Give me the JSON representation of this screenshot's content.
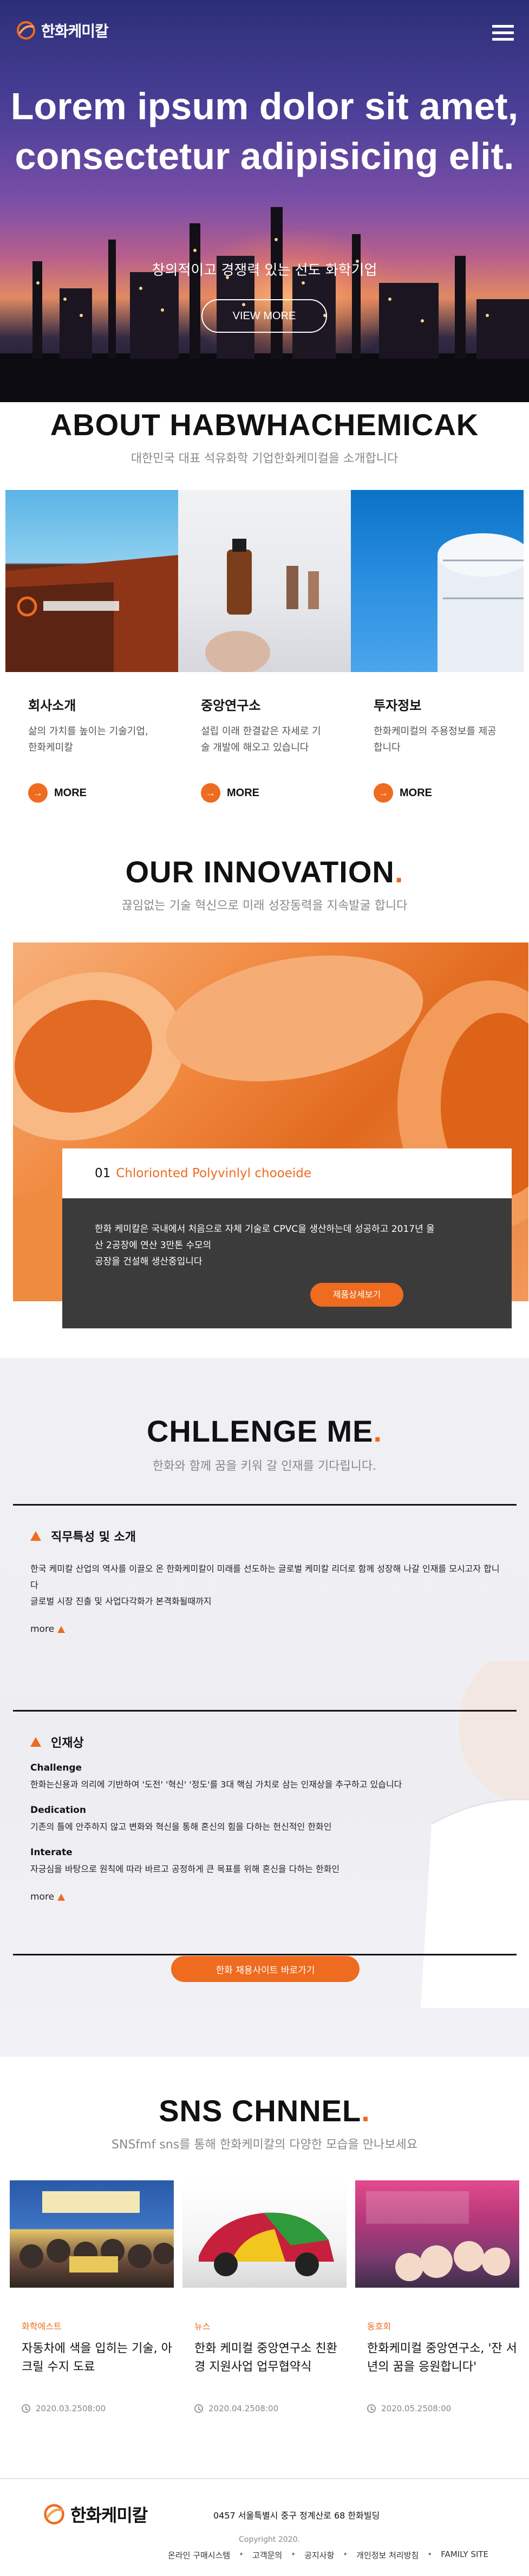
{
  "brand": {
    "logo_text": "한화케미칼",
    "accent": "#ee6b1f"
  },
  "hero": {
    "title": "Lorem ipsum dolor sit amet, consectetur adipisicing elit.",
    "subtitle": "창의적이고 경쟁력 있는 선도 화학기업",
    "button": "VIEW MORE"
  },
  "about": {
    "title": "ABOUT HABWHACHEMICAK",
    "subtitle": "대한민국 대표 석유화학 기업한화케미컬을 소개합니다",
    "cards": [
      {
        "title": "회사소개",
        "text": "삶의 가치를 높이는 기술기업, 한화케미칼",
        "more": "MORE"
      },
      {
        "title": "중앙연구소",
        "text": "설립 이래 한결같은 자세로 기술 개발에 해오고 있습니다",
        "more": "MORE"
      },
      {
        "title": "투자정보",
        "text": "한화케미컬의 주용정보를 제공합니다",
        "more": "MORE"
      }
    ]
  },
  "innovation": {
    "title": "OUR INNOVATION",
    "title_dot": ".",
    "subtitle": "끊임없는 기술 혁신으로 미래 성장동력을 지속발굴 합니다",
    "card": {
      "number": "01",
      "name": "Chlorionted Polyvinlyl chooeide",
      "line1": "한화 케미칼은 국내에서 처음으로 자체 기술로 CPVC을 생산하는데 성공하고 2017년 울산 2공장에 연산 3만톤 수모의",
      "line2": "공장을 건설해 생산중입니다",
      "button": "제품상세보기"
    }
  },
  "challenge": {
    "title": "CHLLENGE ME",
    "title_dot": ".",
    "subtitle": "한화와 함께 꿈을 키워 갈 인재를 기다립니다.",
    "items": [
      {
        "heading": "직무특성 및 소개",
        "text1": "한국 케미칼 산업의 역사를 이끌오 온 한화케미칼이 미래를 선도하는 글로벌 케미칼 리더로 함께 성장해 나갈 인재를 모시고자 합니다",
        "text2": "글로벌 시장 진출 및 사업다각화가 본격화될때까지",
        "more": "more"
      },
      {
        "heading": "인재상",
        "subs": [
          {
            "title": "Challenge",
            "text": "한화는신용과 의리에 기반하여 '도전' '혁신' '정도'를 3대 핵심 가치로 삼는 인재상을 추구하고 있습니다"
          },
          {
            "title": "Dedication",
            "text": "기존의 틀에 안주하지 않고 변화와 혁신을 통해 혼신의 힘을 다하는 헌신적인 한화인"
          },
          {
            "title": "Interate",
            "text": "자긍심을 바탕으로 원칙에 따라 바르고 공정하게 큰 목표를 위해 혼신을 다하는 한화인"
          }
        ],
        "more": "more"
      }
    ],
    "button": "한화 채용사이트 바로가기"
  },
  "sns": {
    "title": "SNS CHNNEL",
    "title_dot": ".",
    "subtitle": "SNSfmf sns를 통해 한화케미칼의 다양한 모습을 만나보세요",
    "posts": [
      {
        "category": "화학에스트",
        "title": "자동차에 색을 입히는 기술, 아크릴 수지 도료",
        "date": "2020.03.2508:00"
      },
      {
        "category": "뉴스",
        "title": "한화 케미컬 중앙연구소 친환경 지원사업 업무협약식",
        "date": "2020.04.2508:00"
      },
      {
        "category": "동호회",
        "title": "한화케미컬 중앙연구소, '잔 서년의 꿈을 응원합니다'",
        "date": "2020.05.2508:00"
      }
    ]
  },
  "footer": {
    "logo_text": "한화케미칼",
    "address": "0457 서울특별시 중구 정계산로 68 한화빌딩",
    "copyright": "Copyright 2020.",
    "links": [
      "온라인 구매시스템",
      "고객문의",
      "공지사항",
      "개인정보 처리방침",
      "FAMILY SITE"
    ]
  }
}
